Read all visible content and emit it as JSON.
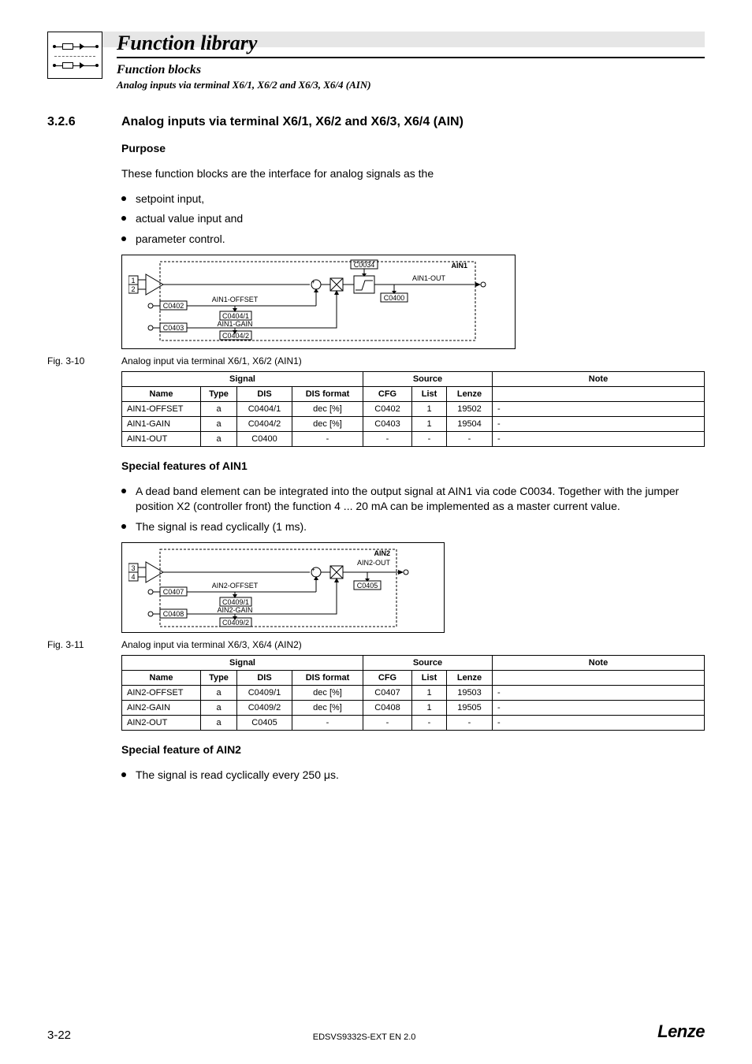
{
  "header": {
    "main": "Function library",
    "sub": "Function blocks",
    "sub2": "Analog inputs via terminal X6/1, X6/2 and X6/3, X6/4 (AIN)"
  },
  "section": {
    "num": "3.2.6",
    "heading": "Analog inputs via terminal X6/1, X6/2 and X6/3, X6/4 (AIN)"
  },
  "purpose": {
    "label": "Purpose",
    "text": "These function blocks are the interface for analog signals as the",
    "bullets": [
      "setpoint input,",
      "actual value input and",
      "parameter control."
    ]
  },
  "fig1": {
    "label": "Fig. 3-10",
    "caption": "Analog input via terminal X6/1, X6/2 (AIN1)",
    "d": {
      "title": "AIN1",
      "out": "AIN1-OUT",
      "offset": "AIN1-OFFSET",
      "gain": "AIN1-GAIN",
      "t1": "1",
      "t2": "2",
      "c0034": "C0034",
      "c0402": "C0402",
      "c0403": "C0403",
      "c0400": "C0400",
      "c04041": "C0404/1",
      "c04042": "C0404/2"
    }
  },
  "table_headers": {
    "signal": "Signal",
    "source": "Source",
    "note": "Note",
    "name": "Name",
    "type": "Type",
    "dis": "DIS",
    "disf": "DIS format",
    "cfg": "CFG",
    "list": "List",
    "lenze": "Lenze"
  },
  "table1": [
    {
      "name": "AIN1-OFFSET",
      "type": "a",
      "dis": "C0404/1",
      "disf": "dec [%]",
      "cfg": "C0402",
      "list": "1",
      "lenze": "19502",
      "note": "-"
    },
    {
      "name": "AIN1-GAIN",
      "type": "a",
      "dis": "C0404/2",
      "disf": "dec [%]",
      "cfg": "C0403",
      "list": "1",
      "lenze": "19504",
      "note": "-"
    },
    {
      "name": "AIN1-OUT",
      "type": "a",
      "dis": "C0400",
      "disf": "-",
      "cfg": "-",
      "list": "-",
      "lenze": "-",
      "note": "-"
    }
  ],
  "special1": {
    "label": "Special features of AIN1",
    "bullets": [
      "A dead band element can be integrated into the output signal at AIN1 via code C0034. Together with the jumper position X2 (controller front) the function 4 ... 20 mA can be implemented as a master current value.",
      "The signal is read cyclically (1 ms)."
    ]
  },
  "fig2": {
    "label": "Fig. 3-11",
    "caption": "Analog input via terminal X6/3, X6/4 (AIN2)",
    "d": {
      "title": "AIN2",
      "out": "AIN2-OUT",
      "offset": "AIN2-OFFSET",
      "gain": "AIN2-GAIN",
      "t1": "3",
      "t2": "4",
      "c0407": "C0407",
      "c0408": "C0408",
      "c0405": "C0405",
      "c04091": "C0409/1",
      "c04092": "C0409/2"
    }
  },
  "table2": [
    {
      "name": "AIN2-OFFSET",
      "type": "a",
      "dis": "C0409/1",
      "disf": "dec [%]",
      "cfg": "C0407",
      "list": "1",
      "lenze": "19503",
      "note": "-"
    },
    {
      "name": "AIN2-GAIN",
      "type": "a",
      "dis": "C0409/2",
      "disf": "dec [%]",
      "cfg": "C0408",
      "list": "1",
      "lenze": "19505",
      "note": "-"
    },
    {
      "name": "AIN2-OUT",
      "type": "a",
      "dis": "C0405",
      "disf": "-",
      "cfg": "-",
      "list": "-",
      "lenze": "-",
      "note": "-"
    }
  ],
  "special2": {
    "label": "Special feature of AIN2",
    "bullets": [
      "The signal is read cyclically every 250 μs."
    ]
  },
  "footer": {
    "page": "3-22",
    "doc": "EDSVS9332S-EXT EN 2.0",
    "brand": "Lenze"
  }
}
